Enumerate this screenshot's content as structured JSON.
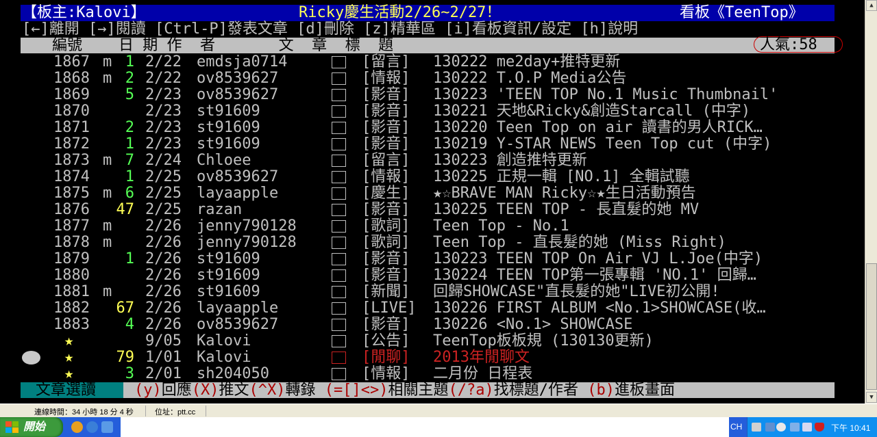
{
  "title_bar": {
    "left": "【板主:Kalovi】",
    "center": "Ricky慶生活動2/26~2/27！",
    "right": "看板《TeenTop》"
  },
  "menu_line": "[←]離開 [→]閱讀 [Ctrl-P]發表文章 [d]刪除 [z]精華區 [i]看板資訊/設定 [h]說明",
  "header": {
    "columns": "編號    日 期 作  者       文  章  標  題",
    "popularity": "人氣:58"
  },
  "rows": [
    {
      "num": "1867",
      "mark": "m",
      "rec": "1",
      "date": "2/22",
      "author": "emdsja0714",
      "cat": "[留言]",
      "title": "130222 me2day+推特更新"
    },
    {
      "num": "1868",
      "mark": "m",
      "rec": "2",
      "date": "2/22",
      "author": "ov8539627",
      "cat": "[情報]",
      "title": "130222 T.O.P Media公告"
    },
    {
      "num": "1869",
      "mark": "",
      "rec": "5",
      "date": "2/23",
      "author": "ov8539627",
      "cat": "[影音]",
      "title": "130223 'TEEN TOP No.1 Music Thumbnail'"
    },
    {
      "num": "1870",
      "mark": "",
      "rec": "",
      "date": "2/23",
      "author": "st91609",
      "cat": "[影音]",
      "title": "130221 天地&Ricky&創造Starcall (中字)"
    },
    {
      "num": "1871",
      "mark": "",
      "rec": "2",
      "date": "2/23",
      "author": "st91609",
      "cat": "[影音]",
      "title": "130220 Teen Top on air 讀書的男人RICK…"
    },
    {
      "num": "1872",
      "mark": "",
      "rec": "1",
      "date": "2/23",
      "author": "st91609",
      "cat": "[影音]",
      "title": "130219 Y-STAR NEWS Teen Top cut (中字)"
    },
    {
      "num": "1873",
      "mark": "m",
      "rec": "7",
      "date": "2/24",
      "author": "Chloee",
      "cat": "[留言]",
      "title": "130223 創造推特更新"
    },
    {
      "num": "1874",
      "mark": "",
      "rec": "1",
      "date": "2/25",
      "author": "ov8539627",
      "cat": "[情報]",
      "title": "130225 正規一輯 [NO.1] 全輯試聽"
    },
    {
      "num": "1875",
      "mark": "m",
      "rec": "6",
      "date": "2/25",
      "author": "layaapple",
      "cat": "[慶生]",
      "title": "★☆BRAVE MAN Ricky☆★生日活動預告"
    },
    {
      "num": "1876",
      "mark": "",
      "rec": "47",
      "date": "2/25",
      "author": "razan",
      "cat": "[影音]",
      "title": "130225 TEEN TOP - 長直髮的她 MV"
    },
    {
      "num": "1877",
      "mark": "m",
      "rec": "",
      "date": "2/26",
      "author": "jenny790128",
      "cat": "[歌詞]",
      "title": "Teen Top - No.1"
    },
    {
      "num": "1878",
      "mark": "m",
      "rec": "",
      "date": "2/26",
      "author": "jenny790128",
      "cat": "[歌詞]",
      "title": "Teen Top - 直長髮的她 (Miss Right)"
    },
    {
      "num": "1879",
      "mark": "",
      "rec": "1",
      "date": "2/26",
      "author": "st91609",
      "cat": "[影音]",
      "title": "130223 TEEN TOP On Air VJ L.Joe(中字)"
    },
    {
      "num": "1880",
      "mark": "",
      "rec": "",
      "date": "2/26",
      "author": "st91609",
      "cat": "[影音]",
      "title": "130224 TEEN TOP第一張專輯 'NO.1' 回歸…"
    },
    {
      "num": "1881",
      "mark": "m",
      "rec": "",
      "date": "2/26",
      "author": "st91609",
      "cat": "[新聞]",
      "title": "回歸SHOWCASE\"直長髮的她\"LIVE初公開!"
    },
    {
      "num": "1882",
      "mark": "",
      "rec": "67",
      "date": "2/26",
      "author": "layaapple",
      "cat": "[LIVE]",
      "title": "130226 FIRST ALBUM <No.1>SHOWCASE(收…"
    },
    {
      "num": "1883",
      "mark": "",
      "rec": "4",
      "date": "2/26",
      "author": "ov8539627",
      "cat": "[影音]",
      "title": "130226 <No.1> SHOWCASE"
    },
    {
      "num": "★",
      "mark": "",
      "rec": "",
      "date": "9/05",
      "author": "Kalovi",
      "cat": "[公告]",
      "title": "TeenTop板板規 (130130更新)"
    },
    {
      "num": "★",
      "mark": "",
      "rec": "79",
      "date": "1/01",
      "author": "Kalovi",
      "cat": "[閒聊]",
      "title": "2013年閒聊文"
    },
    {
      "num": "★",
      "mark": "",
      "rec": "3",
      "date": "2/01",
      "author": "sh204050",
      "cat": "[情報]",
      "title": "二月份 日程表"
    }
  ],
  "footer": {
    "mode": "文章選讀",
    "commands": [
      {
        "key": "(y)",
        "label": "回應"
      },
      {
        "key": "(X)",
        "label": "推文"
      },
      {
        "key": "(^X)",
        "label": "轉錄 "
      },
      {
        "key": "(=[]<>)",
        "label": "相關主題"
      },
      {
        "key": "(/?a)",
        "label": "找標題/作者 "
      },
      {
        "key": "(b)",
        "label": "進板畫面"
      }
    ]
  },
  "status_bar": {
    "connection_time": "連線時間：34 小時 18 分 4 秒",
    "address": "位址：ptt.cc"
  },
  "taskbar": {
    "start": "開始",
    "lang": "CH",
    "clock": "下午 10:41"
  }
}
